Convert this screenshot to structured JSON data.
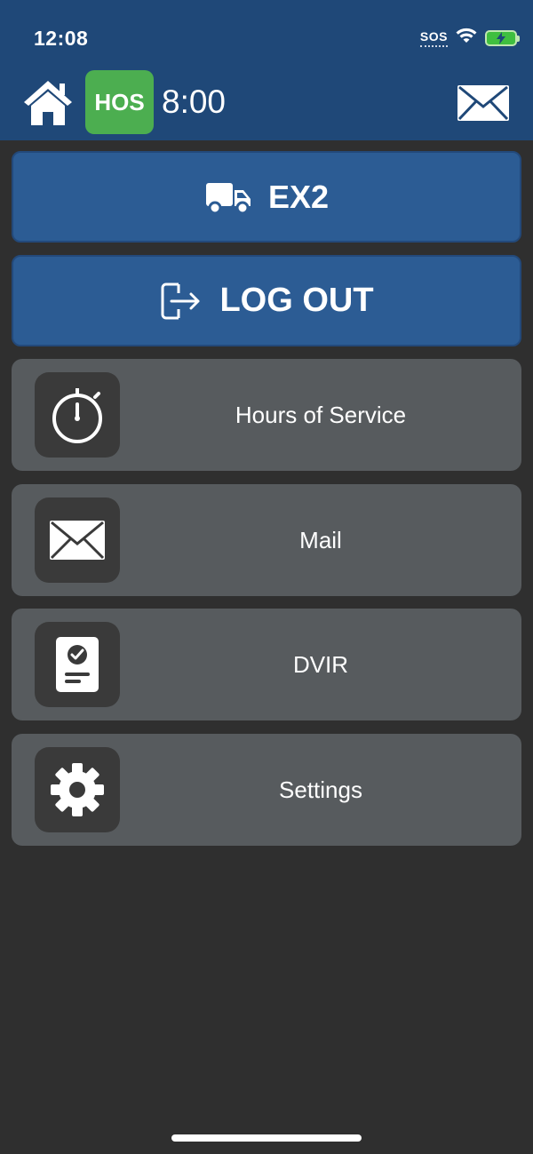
{
  "status_bar": {
    "time": "12:08",
    "sos": "SOS"
  },
  "header": {
    "hos_badge": "HOS",
    "hos_time": "8:00"
  },
  "buttons": {
    "vehicle_label": "EX2",
    "logout_label": "LOG OUT"
  },
  "menu": [
    {
      "label": "Hours of Service",
      "icon": "stopwatch-icon"
    },
    {
      "label": "Mail",
      "icon": "mail-icon"
    },
    {
      "label": "DVIR",
      "icon": "inspection-report-icon"
    },
    {
      "label": "Settings",
      "icon": "gear-icon"
    }
  ],
  "colors": {
    "header_bg": "#1f4878",
    "primary_button": "#2c5c94",
    "menu_item": "#575b5e",
    "hos_badge": "#4cae50",
    "page_bg": "#2f2f2f"
  }
}
